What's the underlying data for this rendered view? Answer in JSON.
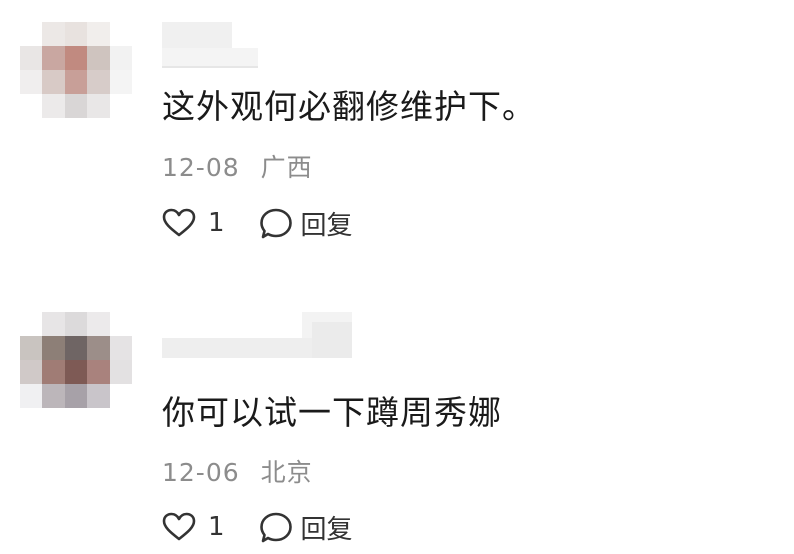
{
  "comments": [
    {
      "text": "这外观何必翻修维护下。",
      "date": "12-08",
      "location": "广西",
      "likes": "1",
      "reply_label": "回复"
    },
    {
      "text": "你可以试一下蹲周秀娜",
      "date": "12-06",
      "location": "北京",
      "likes": "1",
      "reply_label": "回复"
    }
  ],
  "colors": {
    "text": "#1a1a1a",
    "meta": "#8c8c8c",
    "icon": "#333333"
  },
  "icons": {
    "like": "heart-icon",
    "reply": "speech-bubble-icon"
  }
}
